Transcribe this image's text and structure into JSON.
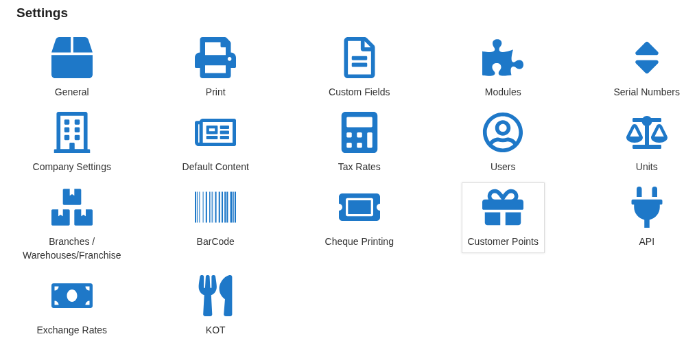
{
  "title": "Settings",
  "items": [
    {
      "label": "General",
      "selected": false
    },
    {
      "label": "Print",
      "selected": false
    },
    {
      "label": "Custom Fields",
      "selected": false
    },
    {
      "label": "Modules",
      "selected": false
    },
    {
      "label": "Serial Numbers",
      "selected": false
    },
    {
      "label": "Company Settings",
      "selected": false
    },
    {
      "label": "Default Content",
      "selected": false
    },
    {
      "label": "Tax Rates",
      "selected": false
    },
    {
      "label": "Users",
      "selected": false
    },
    {
      "label": "Units",
      "selected": false
    },
    {
      "label": "Branches / Warehouses/Franchise",
      "selected": false
    },
    {
      "label": "BarCode",
      "selected": false
    },
    {
      "label": "Cheque Printing",
      "selected": false
    },
    {
      "label": "Customer Points",
      "selected": true
    },
    {
      "label": "API",
      "selected": false
    },
    {
      "label": "Exchange Rates",
      "selected": false
    },
    {
      "label": "KOT",
      "selected": false
    }
  ]
}
